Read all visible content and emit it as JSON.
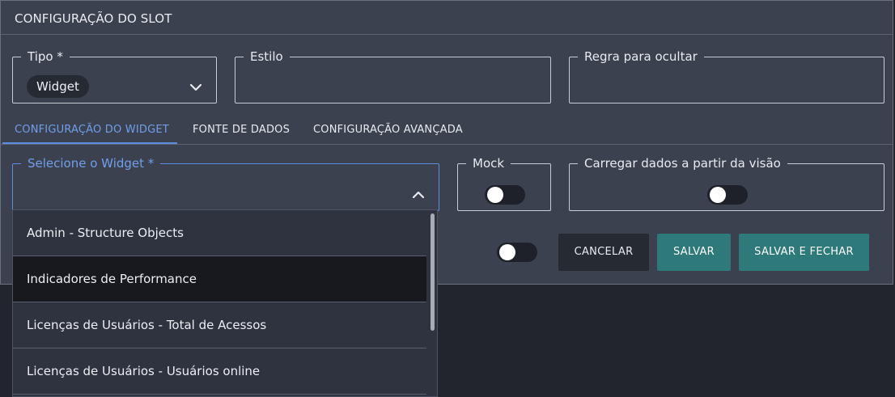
{
  "dialog": {
    "title": "CONFIGURAÇÃO DO SLOT"
  },
  "fields": {
    "tipo": {
      "label": "Tipo *",
      "value": "Widget"
    },
    "estilo": {
      "label": "Estilo"
    },
    "regra": {
      "label": "Regra para ocultar"
    }
  },
  "tabs": [
    {
      "label": "CONFIGURAÇÃO DO WIDGET",
      "active": true
    },
    {
      "label": "FONTE DE DADOS",
      "active": false
    },
    {
      "label": "CONFIGURAÇÃO AVANÇADA",
      "active": false
    }
  ],
  "widget_select": {
    "label": "Selecione o Widget *",
    "options": [
      "Admin - Structure Objects",
      "Indicadores de Performance",
      "Licenças de Usuários - Total de Acessos",
      "Licenças de Usuários - Usuários online"
    ],
    "hovered_option": "Indicadores de Performance"
  },
  "mock": {
    "label": "Mock",
    "on": false
  },
  "carregar": {
    "label": "Carregar dados a partir da visão",
    "on": false
  },
  "extra_toggle": {
    "on": false
  },
  "buttons": {
    "cancel": "CANCELAR",
    "save": "SALVAR",
    "save_close": "SALVAR E FECHAR"
  },
  "colors": {
    "accent": "#5b8ee0",
    "primary_button": "#2e7a7a",
    "dialog_bg": "#3c4150"
  }
}
